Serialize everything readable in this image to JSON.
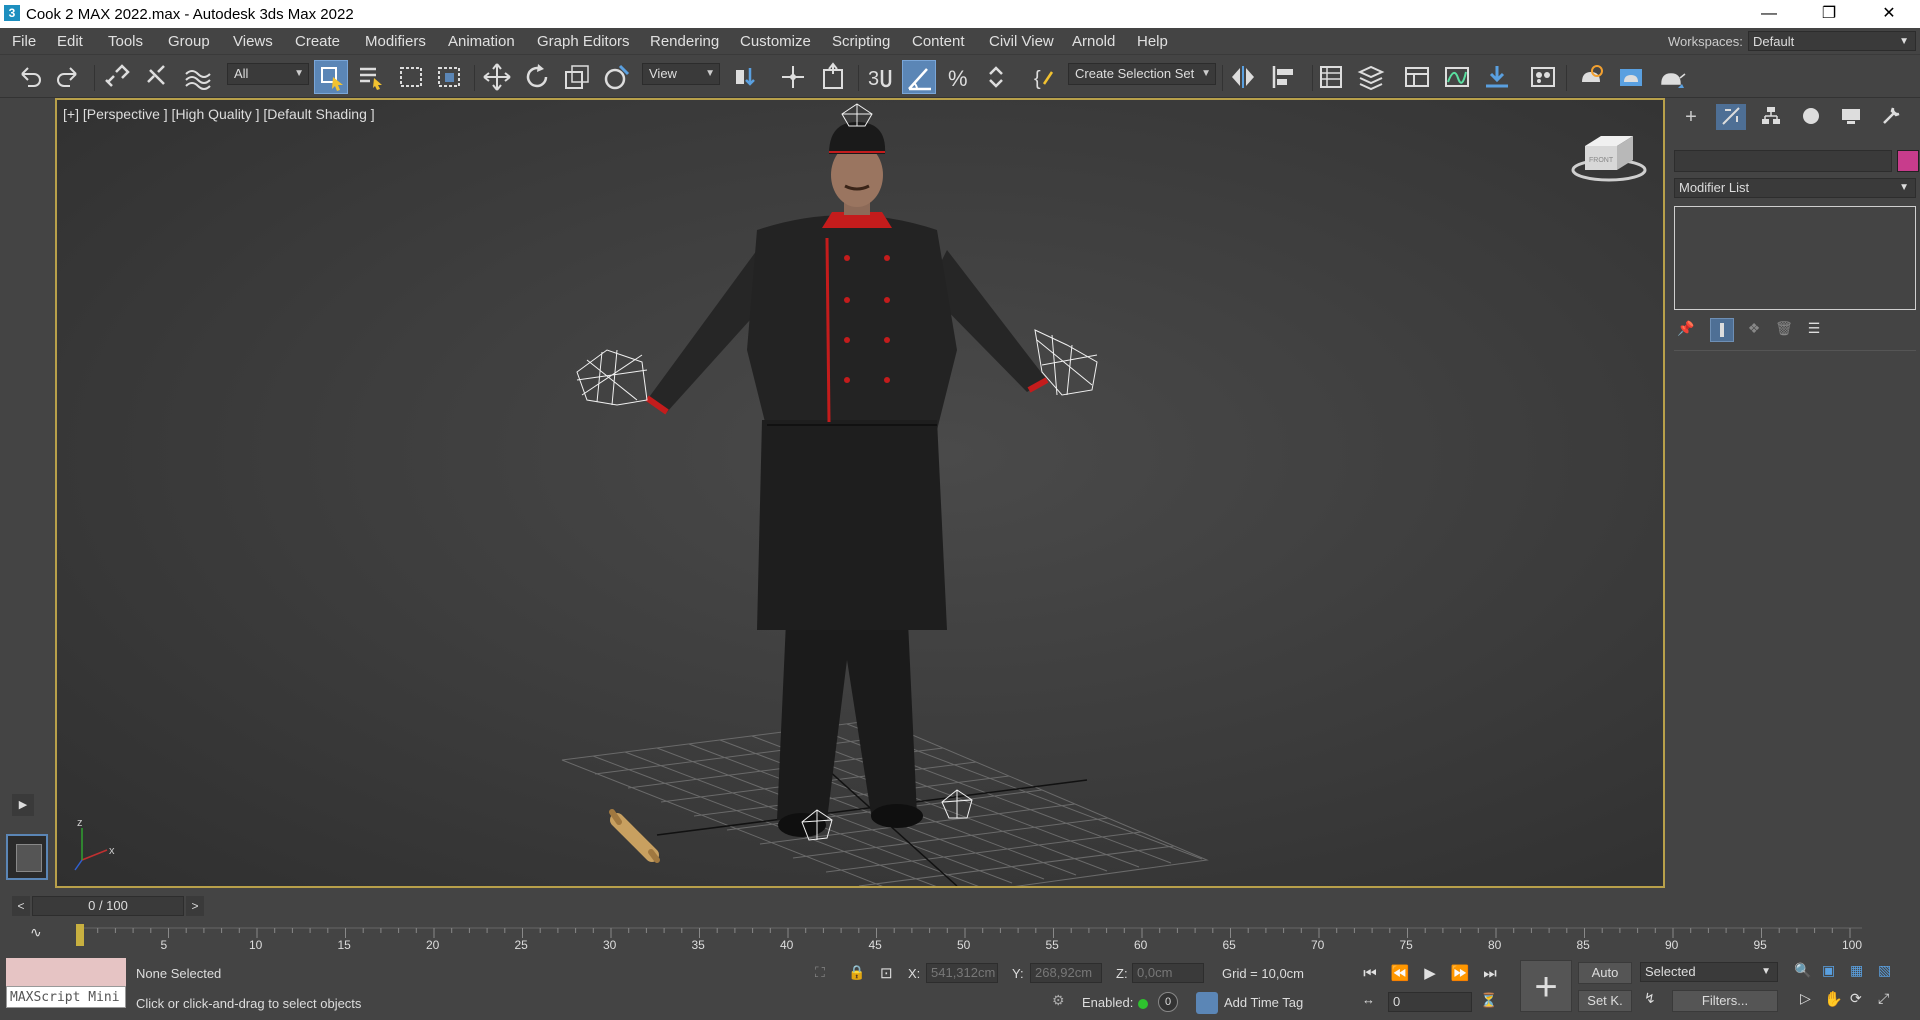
{
  "title": "Cook 2 MAX 2022.max - Autodesk 3ds Max 2022",
  "menu": [
    "File",
    "Edit",
    "Tools",
    "Group",
    "Views",
    "Create",
    "Modifiers",
    "Animation",
    "Graph Editors",
    "Rendering",
    "Customize",
    "Scripting",
    "Content",
    "Civil View",
    "Arnold",
    "Help"
  ],
  "workspaces": {
    "label": "Workspaces:",
    "value": "Default"
  },
  "toolbar": {
    "filter_value": "All",
    "ref_coord_value": "View",
    "selection_set_value": "Create Selection Set"
  },
  "viewport": {
    "label": "[+] [Perspective ] [High Quality ] [Default Shading ]",
    "viewcube_label": "FRONT",
    "axis_labels": {
      "x": "x",
      "y": "y",
      "z": "z"
    }
  },
  "command_panel": {
    "modifier_list": "Modifier List",
    "tab_icons": [
      "create-icon",
      "modify-icon",
      "hierarchy-icon",
      "motion-icon",
      "display-icon",
      "utilities-icon"
    ]
  },
  "time": {
    "slider_text": "0 / 100",
    "prev": "<",
    "next": ">",
    "ticks": [
      "5",
      "10",
      "15",
      "20",
      "25",
      "30",
      "35",
      "40",
      "45",
      "50",
      "55",
      "60",
      "65",
      "70",
      "75",
      "80",
      "85",
      "90",
      "95",
      "100"
    ]
  },
  "status": {
    "maxscript": "MAXScript Mini",
    "selection": "None Selected",
    "prompt": "Click or click-and-drag to select objects",
    "x_label": "X:",
    "x_value": "541,312cm",
    "y_label": "Y:",
    "y_value": "268,92cm",
    "z_label": "Z:",
    "z_value": "0,0cm",
    "grid": "Grid = 10,0cm",
    "enabled_label": "Enabled:",
    "add_time_tag": "Add Time Tag",
    "auto": "Auto",
    "set_key": "Set K.",
    "key_filter": "Selected",
    "filters": "Filters...",
    "frame_value": "0"
  },
  "colors": {
    "accent": "#5b86b6",
    "viewport_border": "#b8a04a",
    "object_color": "#c83c8c"
  }
}
